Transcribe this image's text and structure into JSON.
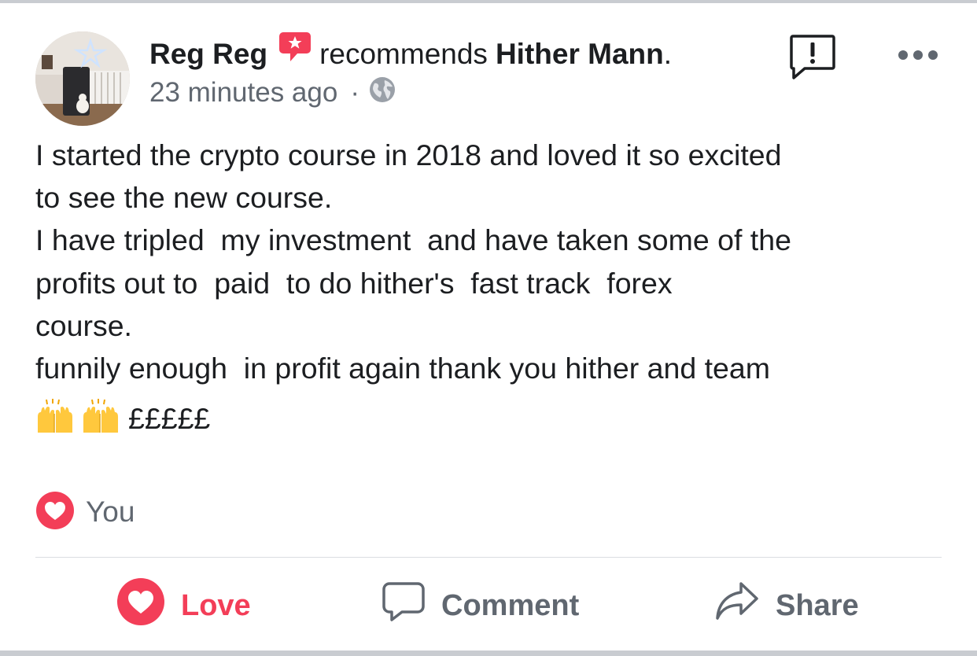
{
  "post": {
    "author": "Reg Reg",
    "recommends_text": "recommends",
    "target": "Hither Mann",
    "target_suffix": ".",
    "timestamp": "23 minutes ago",
    "separator": "·",
    "privacy_icon": "globe-icon",
    "body_lines": [
      "I started the crypto course in 2018 and loved it so excited",
      "to see the new course.",
      "I have tripled  my investment  and have taken some of the",
      "profits out to  paid  to do hither's  fast track  forex",
      "course.",
      "funnily enough  in profit again thank you hither and team"
    ],
    "emoji_line": {
      "emoji_icons": [
        "raising-hands-icon",
        "raising-hands-icon"
      ],
      "text": "£££££"
    }
  },
  "reactions": {
    "icon": "love-reaction-icon",
    "summary": "You"
  },
  "actions": {
    "love_label": "Love",
    "comment_label": "Comment",
    "share_label": "Share"
  },
  "colors": {
    "love": "#f33e58",
    "secondary_text": "#606770",
    "primary_text": "#1c1e21",
    "divider": "#dadde1"
  }
}
